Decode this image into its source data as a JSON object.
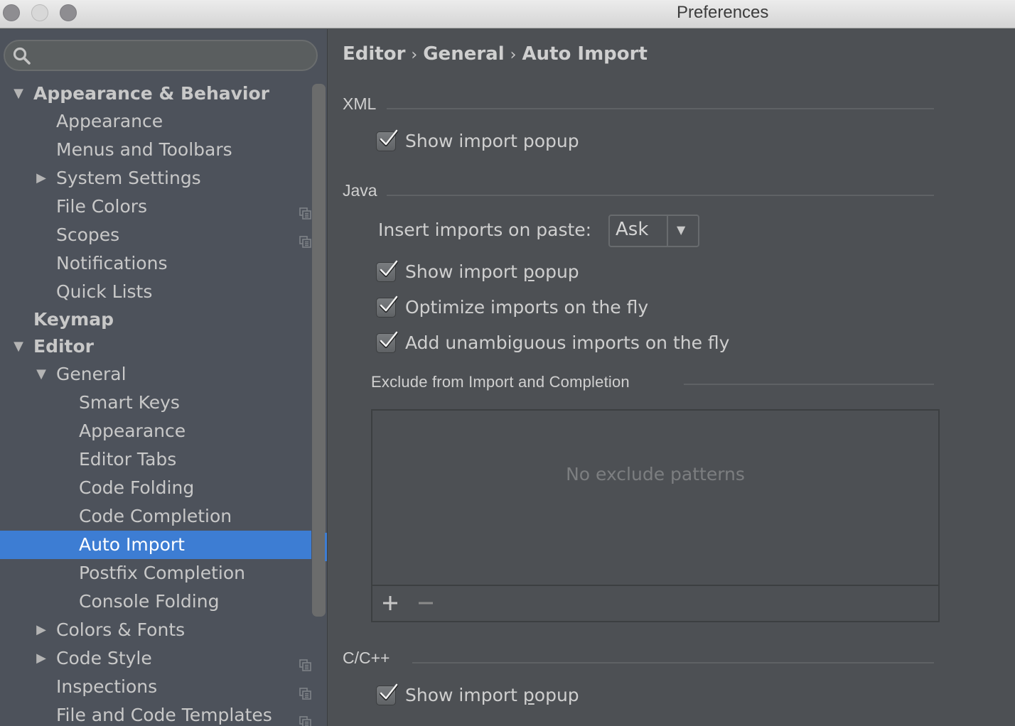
{
  "window": {
    "title": "Preferences",
    "controls": [
      "close",
      "minimize",
      "zoom"
    ]
  },
  "sidebar": {
    "search": {
      "value": "",
      "placeholder": ""
    },
    "items": [
      {
        "label": "Appearance & Behavior",
        "level": 0,
        "bold": true,
        "arrow": "expanded"
      },
      {
        "label": "Appearance",
        "level": 1
      },
      {
        "label": "Menus and Toolbars",
        "level": 1
      },
      {
        "label": "System Settings",
        "level": 1,
        "arrow": "collapsed"
      },
      {
        "label": "File Colors",
        "level": 1,
        "project_icon": true
      },
      {
        "label": "Scopes",
        "level": 1,
        "project_icon": true
      },
      {
        "label": "Notifications",
        "level": 1
      },
      {
        "label": "Quick Lists",
        "level": 1
      },
      {
        "label": "Keymap",
        "level": 0,
        "bold": true
      },
      {
        "label": "Editor",
        "level": 0,
        "bold": true,
        "arrow": "expanded"
      },
      {
        "label": "General",
        "level": 1,
        "arrow": "expanded"
      },
      {
        "label": "Smart Keys",
        "level": 2
      },
      {
        "label": "Appearance",
        "level": 2
      },
      {
        "label": "Editor Tabs",
        "level": 2
      },
      {
        "label": "Code Folding",
        "level": 2
      },
      {
        "label": "Code Completion",
        "level": 2
      },
      {
        "label": "Auto Import",
        "level": 2,
        "selected": true
      },
      {
        "label": "Postfix Completion",
        "level": 2
      },
      {
        "label": "Console Folding",
        "level": 2
      },
      {
        "label": "Colors & Fonts",
        "level": 1,
        "arrow": "collapsed"
      },
      {
        "label": "Code Style",
        "level": 1,
        "arrow": "collapsed",
        "project_icon": true
      },
      {
        "label": "Inspections",
        "level": 1,
        "project_icon": true
      },
      {
        "label": "File and Code Templates",
        "level": 1,
        "project_icon": true
      }
    ],
    "arrows": {
      "expanded": "▼",
      "collapsed": "▶"
    }
  },
  "main": {
    "breadcrumb": [
      "Editor",
      "General",
      "Auto Import"
    ],
    "breadcrumb_sep": "›",
    "xml": {
      "title": "XML",
      "show_import_popup": {
        "label": "Show import popup",
        "checked": true
      }
    },
    "java": {
      "title": "Java",
      "insert_imports_label": "Insert imports on paste:",
      "insert_imports_value": "Ask",
      "show_import_popup": {
        "label_pre": "Show import ",
        "label_mnemonic": "p",
        "label_post": "opup",
        "checked": true
      },
      "optimize_imports": {
        "label": "Optimize imports on the fly",
        "checked": true
      },
      "add_unambiguous": {
        "label": "Add unambiguous imports on the fly",
        "checked": true
      },
      "exclude": {
        "title": "Exclude from Import and Completion",
        "empty_text": "No exclude patterns",
        "add_label": "+",
        "remove_label": "−"
      }
    },
    "cpp": {
      "title": "C/C++",
      "show_import_popup": {
        "label_pre": "Show import ",
        "label_mnemonic": "p",
        "label_post": "opup",
        "checked": true
      }
    }
  },
  "colors": {
    "selection": "#3d7dd3",
    "sidebar_bg": "#4d525b",
    "panel_bg": "#4d5054",
    "text": "#cfcfcf"
  }
}
